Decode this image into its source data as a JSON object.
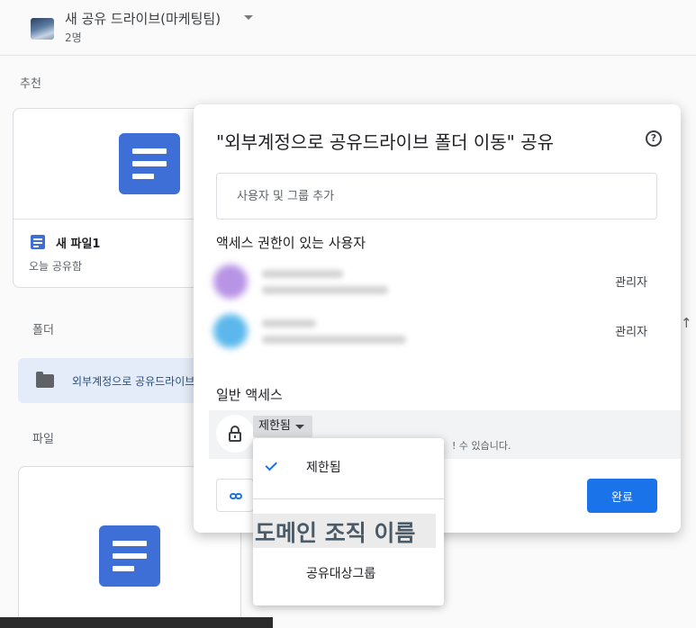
{
  "drive": {
    "name": "새 공유 드라이브(마케팅팀)",
    "members": "2명"
  },
  "sections": {
    "suggested": "추천",
    "folders": "폴더",
    "files": "파일"
  },
  "suggested_file": {
    "name": "새 파일1",
    "subtitle": "오늘 공유함"
  },
  "folder": {
    "name": "외부계정으로 공유드라이브 폴더 이동"
  },
  "share_dialog": {
    "title": "\"외부계정으로 공유드라이브 폴더 이동\" 공유",
    "help_icon": "help-circle-icon",
    "add_placeholder": "사용자 및 그룹 추가",
    "people_heading": "액세스 권한이 있는 사용자",
    "people": [
      {
        "role": "관리자",
        "avatar_color": "#b894e6"
      },
      {
        "role": "관리자",
        "avatar_color": "#5cb8ec"
      }
    ],
    "general_access_heading": "일반 액세스",
    "access_selected": "제한됨",
    "access_description": "! 수 있습니다.",
    "copy_link_icon": "link-icon",
    "done_label": "완료"
  },
  "access_menu": {
    "items": [
      {
        "label": "제한됨",
        "checked": true
      },
      {
        "label": "도메인 조직 이름",
        "highlighted": true
      },
      {
        "label": "공유대상그룹"
      }
    ]
  },
  "colors": {
    "accent": "#1a73e8",
    "doc_icon": "#3d6fd6"
  }
}
